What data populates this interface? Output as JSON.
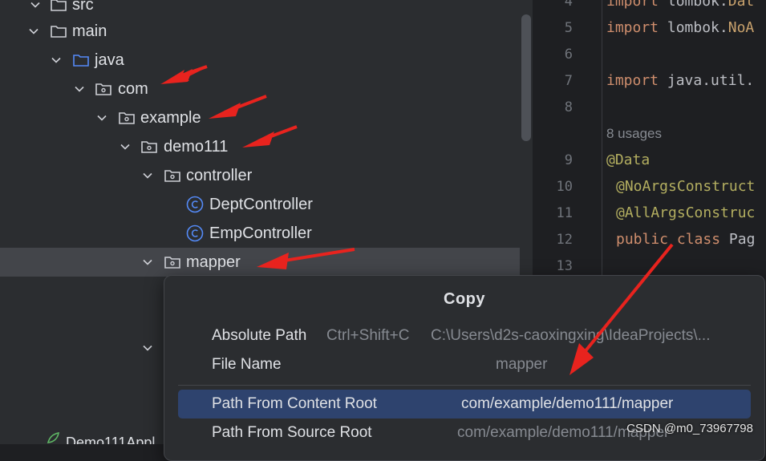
{
  "project_tree": {
    "items": [
      {
        "label": "src",
        "icon": "folder-icon"
      },
      {
        "label": "main",
        "icon": "folder-icon"
      },
      {
        "label": "java",
        "icon": "source-folder-icon"
      },
      {
        "label": "com",
        "icon": "package-icon"
      },
      {
        "label": "example",
        "icon": "package-icon"
      },
      {
        "label": "demo111",
        "icon": "package-icon"
      },
      {
        "label": "controller",
        "icon": "package-icon"
      },
      {
        "label": "DeptController",
        "icon": "class-icon"
      },
      {
        "label": "EmpController",
        "icon": "class-icon"
      },
      {
        "label": "mapper",
        "icon": "package-icon",
        "selected": true
      }
    ],
    "bottom_item": {
      "label": "Demo111Appl"
    }
  },
  "editor": {
    "lines": [
      {
        "num": "4",
        "text": "import lombok.Dat"
      },
      {
        "num": "5",
        "text": "import lombok.NoA"
      },
      {
        "num": "6",
        "text": ""
      },
      {
        "num": "7",
        "text": "import java.util."
      },
      {
        "num": "8",
        "text": ""
      },
      {
        "num": "",
        "text": "8 usages"
      },
      {
        "num": "9",
        "text": "@Data"
      },
      {
        "num": "10",
        "text": "@NoArgsConstruct"
      },
      {
        "num": "11",
        "text": "@AllArgsConstruc"
      },
      {
        "num": "12",
        "text": "public class Pag"
      },
      {
        "num": "13",
        "text": ""
      }
    ]
  },
  "context_menu": {
    "title": "Copy",
    "items": [
      {
        "label": "Absolute Path",
        "shortcut": "Ctrl+Shift+C",
        "value": "C:\\Users\\d2s-caoxingxing\\IdeaProjects\\..."
      },
      {
        "label": "File Name",
        "shortcut": "",
        "value": "mapper"
      },
      {
        "label": "Path From Content Root",
        "shortcut": "",
        "value": "com/example/demo111/mapper",
        "active": true
      },
      {
        "label": "Path From Source Root",
        "shortcut": "",
        "value": "com/example/demo111/mapper"
      }
    ]
  },
  "watermark": "CSDN @m0_73967798",
  "colors": {
    "tree_bg": "#2b2d30",
    "editor_bg": "#1e1f22",
    "selected_row": "#43454a",
    "menu_active": "#2e436e",
    "keyword": "#cf8e6d",
    "annotation": "#b3ae60",
    "arrow": "#e8231e"
  }
}
